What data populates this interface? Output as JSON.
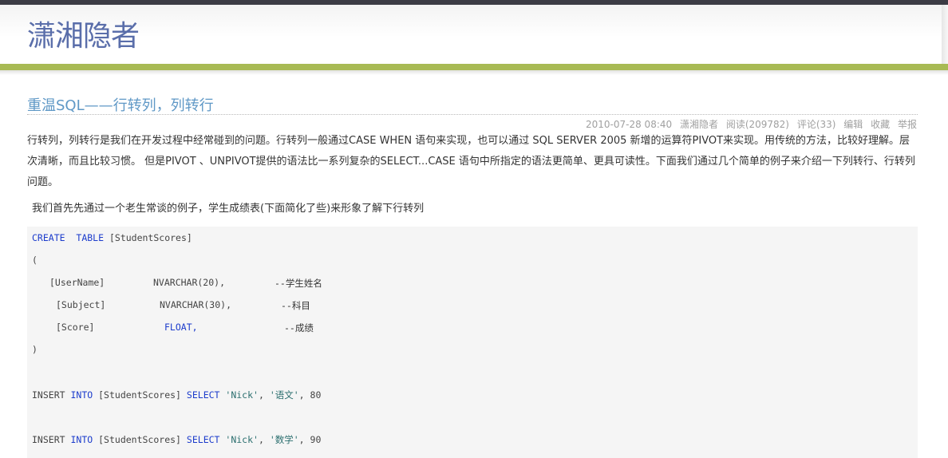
{
  "site": {
    "title": "潇湘隐者"
  },
  "post": {
    "title": "重温SQL——行转列，列转行",
    "meta": {
      "datetime": "2010-07-28 08:40",
      "author": "潇湘隐者",
      "reads": "阅读(209782)",
      "comments": "评论(33)",
      "edit": "编辑",
      "favorite": "收藏",
      "report": "举报"
    },
    "paragraph1": "行转列，列转行是我们在开发过程中经常碰到的问题。行转列一般通过CASE WHEN 语句来实现，也可以通过 SQL SERVER 2005 新增的运算符PIVOT来实现。用传统的方法，比较好理解。层次清晰，而且比较习惯。 但是PIVOT 、UNPIVOT提供的语法比一系列复杂的SELECT...CASE 语句中所指定的语法更简单、更具可读性。下面我们通过几个简单的例子来介绍一下列转行、行转列问题。",
    "paragraph2": "我们首先先通过一个老生常谈的例子，学生成绩表(下面简化了些)来形象了解下行转列"
  },
  "code": {
    "create_kw": "CREATE",
    "table_kw": "TABLE",
    "table_name": "[StudentScores]",
    "open_paren": "(",
    "col1_name": "[UserName]",
    "col1_type": "NVARCHAR(20),",
    "col1_comment": "--学生姓名",
    "col2_name": "[Subject]",
    "col2_type": "NVARCHAR(30),",
    "col2_comment": "--科目",
    "col3_name": "[Score]",
    "col3_type": "FLOAT,",
    "col3_comment": "--成绩",
    "close_paren": ")",
    "insert1": {
      "insert_kw": "INSERT",
      "into_kw": "INTO",
      "table": "[StudentScores]",
      "select_kw": "SELECT",
      "name": "'Nick'",
      "subject": "'语文'",
      "score": "80"
    },
    "insert2": {
      "insert_kw": "INSERT",
      "into_kw": "INTO",
      "table": "[StudentScores]",
      "select_kw": "SELECT",
      "name": "'Nick'",
      "subject": "'数学'",
      "score": "90"
    }
  },
  "colors": {
    "site_title": "#5a6eaa",
    "post_title": "#5f98c6",
    "green_band": "#a8ba54",
    "keyword": "#1c3ccc"
  }
}
